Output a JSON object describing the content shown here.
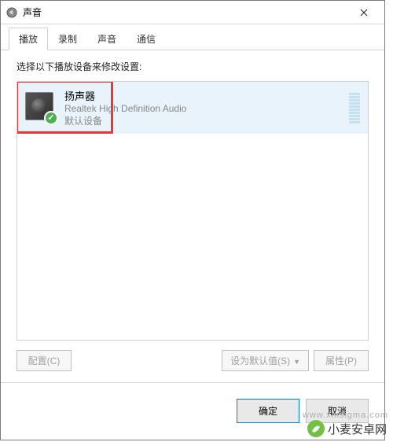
{
  "window": {
    "title": "声音"
  },
  "tabs": {
    "playback": "播放",
    "recording": "录制",
    "sounds": "声音",
    "communications": "通信"
  },
  "instruction": "选择以下播放设备来修改设置:",
  "device": {
    "name": "扬声器",
    "driver": "Realtek High Definition Audio",
    "status": "默认设备"
  },
  "buttons": {
    "configure": "配置(C)",
    "setDefault": "设为默认值(S)",
    "properties": "属性(P)",
    "ok": "确定",
    "cancel": "取消"
  },
  "watermarks": {
    "site": "www.xmsigma.com",
    "brand": "小麦安卓网"
  }
}
